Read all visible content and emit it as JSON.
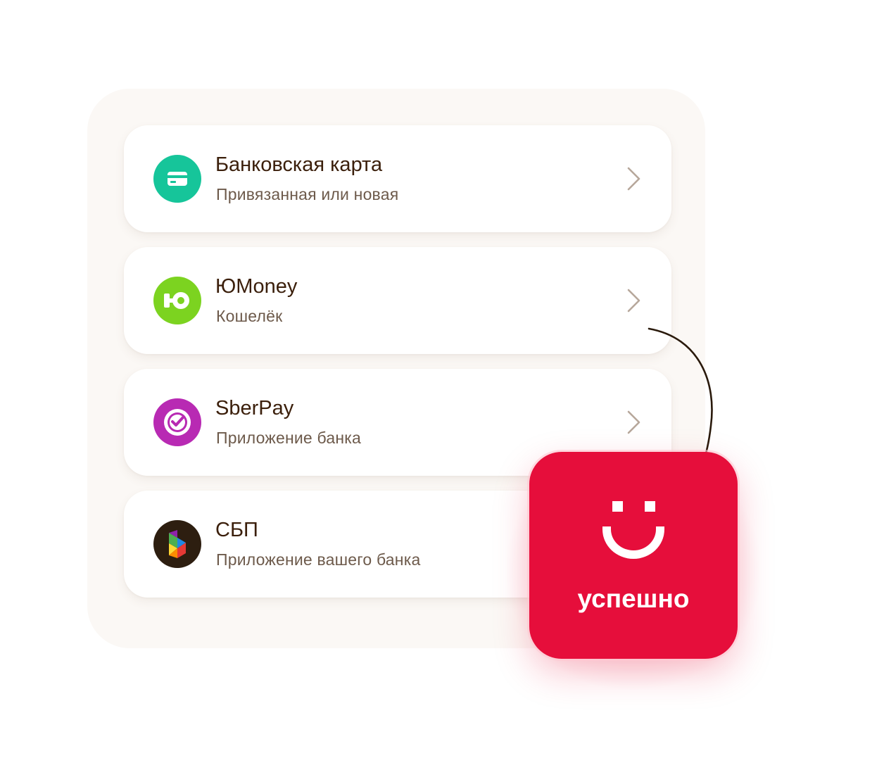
{
  "payment_methods": [
    {
      "title": "Банковская карта",
      "subtitle": "Привязанная или новая",
      "icon": "bank-card-icon",
      "color": "#16c59a"
    },
    {
      "title": "ЮMoney",
      "subtitle": "Кошелёк",
      "icon": "yumoney-logo-icon",
      "color": "#7cd320"
    },
    {
      "title": "SberPay",
      "subtitle": "Приложение банка",
      "icon": "sberpay-logo-icon",
      "color": "#b82ab3"
    },
    {
      "title": "СБП",
      "subtitle": "Приложение вашего банка",
      "icon": "sbp-logo-icon",
      "color": "#2d1e10"
    }
  ],
  "success": {
    "label": "успешно",
    "icon": "smile-icon",
    "color": "#e60e3b"
  },
  "colors": {
    "title": "#3b1f0b",
    "subtitle": "#6d5a4b",
    "chevron": "#b7a79b",
    "panel": "#fbf8f5"
  }
}
